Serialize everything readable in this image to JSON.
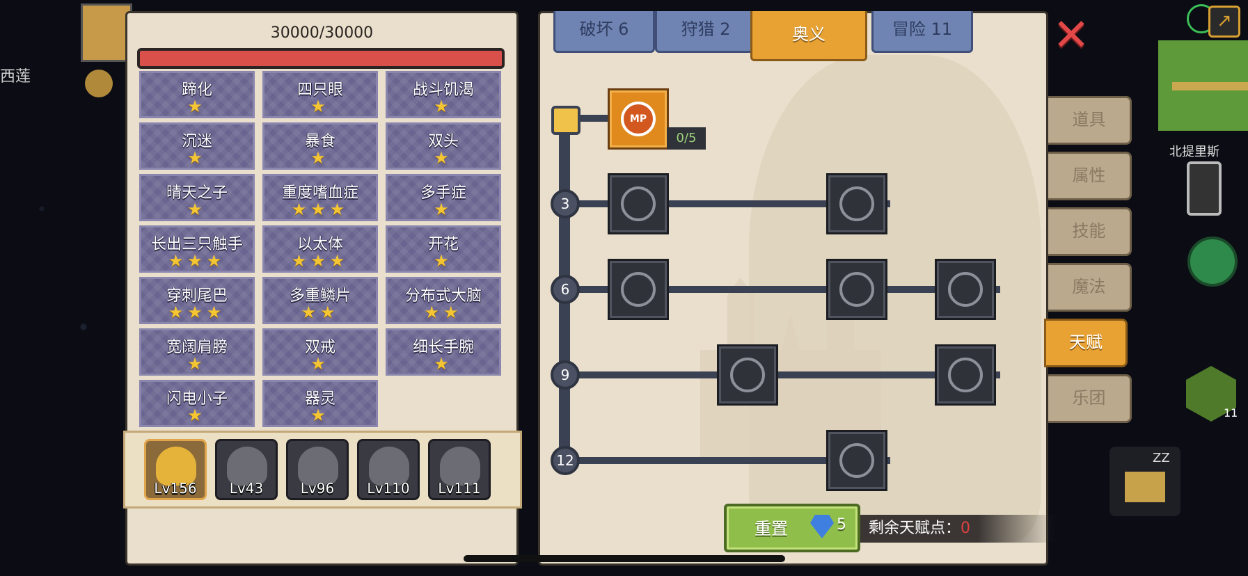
{
  "hp": {
    "text": "30000/30000",
    "fill": 1.0
  },
  "traits": [
    {
      "name": "蹄化",
      "stars": "★"
    },
    {
      "name": "四只眼",
      "stars": "★"
    },
    {
      "name": "战斗饥渴",
      "stars": "★"
    },
    {
      "name": "沉迷",
      "stars": "★"
    },
    {
      "name": "暴食",
      "stars": "★"
    },
    {
      "name": "双头",
      "stars": "★"
    },
    {
      "name": "晴天之子",
      "stars": "★"
    },
    {
      "name": "重度嗜血症",
      "stars": "★★★"
    },
    {
      "name": "多手症",
      "stars": "★"
    },
    {
      "name": "长出三只触手",
      "stars": "★★★"
    },
    {
      "name": "以太体",
      "stars": "★★★"
    },
    {
      "name": "开花",
      "stars": "★"
    },
    {
      "name": "穿刺尾巴",
      "stars": "★★★"
    },
    {
      "name": "多重鳞片",
      "stars": "★★"
    },
    {
      "name": "分布式大脑",
      "stars": "★★"
    },
    {
      "name": "宽阔肩膀",
      "stars": "★"
    },
    {
      "name": "双戒",
      "stars": "★"
    },
    {
      "name": "细长手腕",
      "stars": "★"
    },
    {
      "name": "闪电小子",
      "stars": "★"
    },
    {
      "name": "器灵",
      "stars": "★"
    }
  ],
  "party": [
    {
      "level": "Lv156",
      "selected": true
    },
    {
      "level": "Lv43",
      "selected": false
    },
    {
      "level": "Lv96",
      "selected": false
    },
    {
      "level": "Lv110",
      "selected": false
    },
    {
      "level": "Lv111",
      "selected": false
    }
  ],
  "tabs": [
    {
      "label": "破坏 6",
      "active": false
    },
    {
      "label": "狩猎 2",
      "active": false
    },
    {
      "label": "奥义",
      "active": true
    },
    {
      "label": "冒险 11",
      "active": false
    }
  ],
  "tree": {
    "top_skill": {
      "icon_text": "MP",
      "count": "0/5"
    },
    "rows": [
      {
        "level": "3"
      },
      {
        "level": "6"
      },
      {
        "level": "9"
      },
      {
        "level": "12"
      }
    ]
  },
  "reset": {
    "label": "重置",
    "cost": "5"
  },
  "remaining": {
    "label": "剩余天赋点：",
    "value": "0"
  },
  "side_menu": [
    {
      "label": "道具",
      "active": false
    },
    {
      "label": "属性",
      "active": false
    },
    {
      "label": "技能",
      "active": false
    },
    {
      "label": "魔法",
      "active": false
    },
    {
      "label": "天赋",
      "active": true
    },
    {
      "label": "乐团",
      "active": false
    }
  ],
  "hud": {
    "location": "北提里斯",
    "hex_count": "11",
    "top_left_hint": "西莲",
    "house_zz": "ZZ"
  },
  "colors": {
    "accent": "#e7a233",
    "hp": "#d9504a",
    "star": "#f5c634",
    "remaining_value": "#e04040"
  }
}
